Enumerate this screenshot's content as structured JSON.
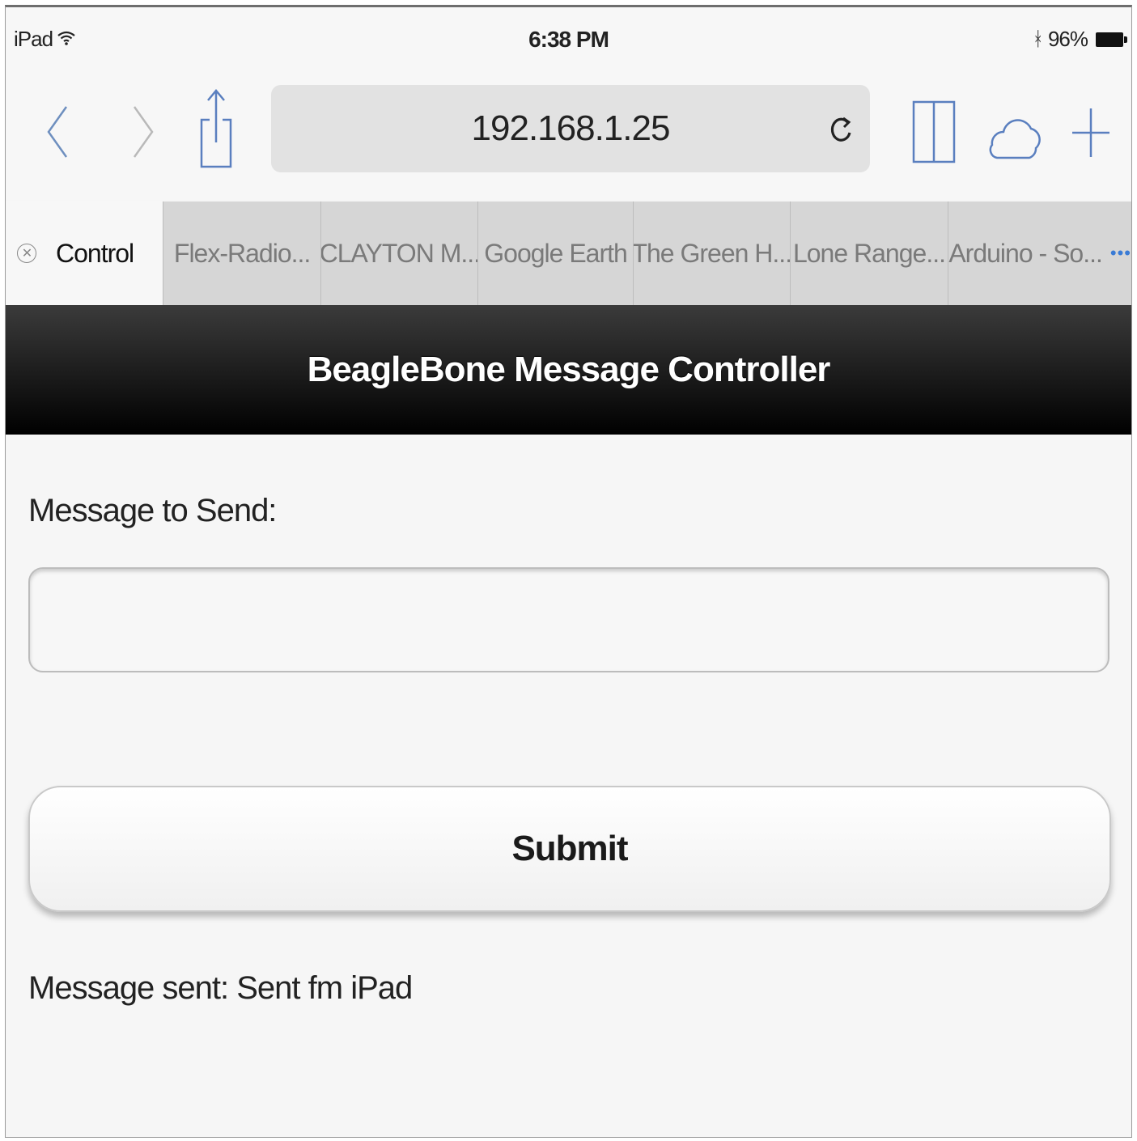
{
  "status_bar": {
    "device": "iPad",
    "time": "6:38 PM",
    "battery": "96%"
  },
  "browser": {
    "url": "192.168.1.25",
    "icons": {
      "back": "chevron-left-icon",
      "forward": "chevron-right-icon",
      "share": "share-icon",
      "reload": "reload-icon",
      "bookmarks": "book-icon",
      "icloud_tabs": "cloud-icon",
      "new_tab": "plus-icon"
    },
    "tabs": [
      {
        "label": "Control",
        "active": true
      },
      {
        "label": "Flex-Radio..."
      },
      {
        "label": "CLAYTON M..."
      },
      {
        "label": "Google Earth"
      },
      {
        "label": "The Green H..."
      },
      {
        "label": "Lone Range..."
      },
      {
        "label": "Arduino - So..."
      }
    ]
  },
  "app": {
    "title": "BeagleBone Message Controller",
    "message_label": "Message to Send:",
    "message_value": "",
    "submit_label": "Submit",
    "status_message": "Message sent: Sent fm iPad"
  },
  "colors": {
    "header_bg": "#0c0c0c",
    "tab_bg": "#d6d6d6",
    "accent": "#3a7bd5"
  }
}
